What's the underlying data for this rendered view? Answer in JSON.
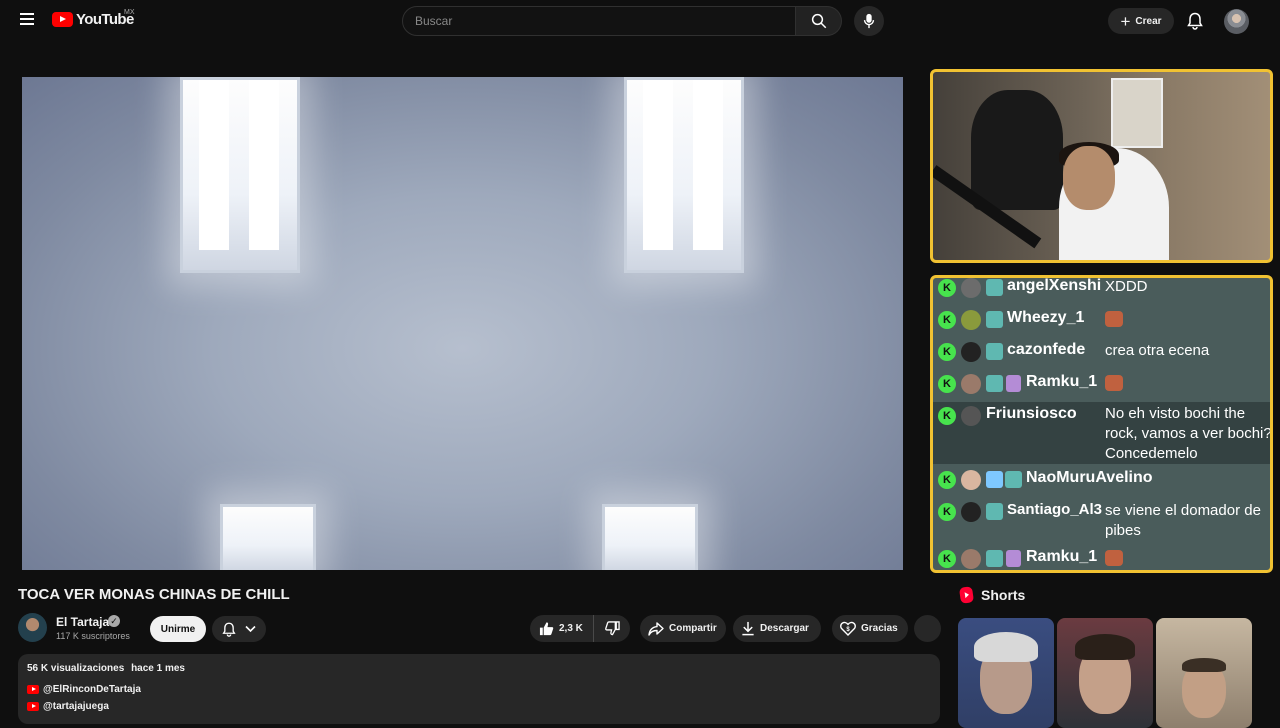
{
  "header": {
    "logo_text": "YouTube",
    "region": "MX",
    "search_placeholder": "Buscar",
    "create_label": "Crear"
  },
  "chat": {
    "messages": [
      {
        "user": "angelXenshi",
        "text": "XDDD"
      },
      {
        "user": "Wheezy_1",
        "text": ""
      },
      {
        "user": "cazonfede",
        "text": "crea otra ecena"
      },
      {
        "user": "Ramku_1",
        "text": ""
      },
      {
        "user": "Friunsiosco",
        "text": "No eh visto bochi the rock, vamos a ver bochi? Concedemelo"
      },
      {
        "user": "NaoMuruAvelino",
        "text": ""
      },
      {
        "user": "Santiago_Al3",
        "text": "se viene el domador de pibes"
      },
      {
        "user": "Ramku_1",
        "text": ""
      }
    ],
    "k_badge": "K",
    "colors": {
      "border": "#f1c232",
      "kick_green": "#47e34d",
      "background": "#4a5c5b"
    }
  },
  "video": {
    "title": "TOCA VER MONAS CHINAS DE CHILL",
    "channel_name": "El Tartaja",
    "verified_mark": "✓",
    "subscribers": "117 K suscriptores",
    "join_label": "Unirme",
    "likes": "2,3 K",
    "share_label": "Compartir",
    "download_label": "Descargar",
    "thanks_label": "Gracias"
  },
  "description": {
    "views": "56 K visualizaciones",
    "date": "hace 1 mes",
    "links": [
      "@ElRinconDeTartaja",
      "@tartajajuega"
    ]
  },
  "shorts": {
    "title": "Shorts"
  },
  "icons": [
    "menu-icon",
    "search-icon",
    "mic-icon",
    "plus-icon",
    "bell-icon",
    "like-icon",
    "dislike-icon",
    "share-icon",
    "download-icon",
    "thanks-icon",
    "chevron-down-icon",
    "shorts-icon"
  ]
}
